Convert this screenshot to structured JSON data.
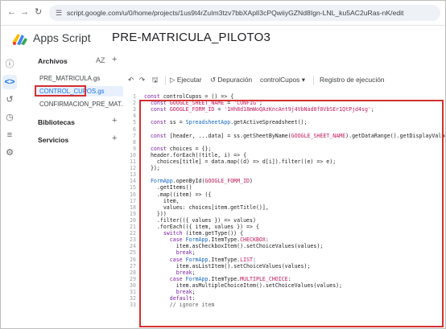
{
  "browser": {
    "url": "script.google.com/u/0/home/projects/1us9t4rZuIm3tzv7bbXAplI3cPQwiiyGZNd8Ign-LNL_ku5AC2uRas-nK/edit",
    "back_icon": "arrow-left-icon",
    "forward_icon": "arrow-right-icon",
    "reload_icon": "reload-icon"
  },
  "header": {
    "app_name": "Apps Script",
    "project_title": "PRE-MATRICULA_PILOTO3"
  },
  "files_panel": {
    "archivos_label": "Archivos",
    "sort_label": "AZ",
    "files": [
      {
        "name": "PRE_MATRICULA.gs",
        "active": false
      },
      {
        "name": "CONTROL_CUPOS.gs",
        "active": true
      },
      {
        "name": "CONFIRMACION_PRE_MAT...",
        "active": false
      }
    ],
    "bibliotecas_label": "Bibliotecas",
    "servicios_label": "Servicios"
  },
  "toolbar": {
    "run_label": "Ejecutar",
    "debug_label": "Depuración",
    "function_select": "controlCupos",
    "log_label": "Registro de ejecución"
  },
  "editor": {
    "lines": [
      "const controlCupos = () => {",
      "  const GOOGLE_SHEET_NAME = 'CONFIG';",
      "  const GOOGLE_FORM_ID = '1Hh8d18mWoQAzKncAnt9j4VbNad0f0VbSEr1QtPjd4sg';",
      "",
      "  const ss = SpreadsheetApp.getActiveSpreadsheet();",
      "",
      "  const [header, ...data] = ss.getSheetByName(GOOGLE_SHEET_NAME).getDataRange().getDisplayValues();",
      "",
      "  const choices = {};",
      "  header.forEach((title, i) => {",
      "    choices[title] = data.map((d) => d[i]).filter((e) => e);",
      "  });",
      "",
      "  FormApp.openById(GOOGLE_FORM_ID)",
      "    .getItems()",
      "    .map((item) => ({",
      "      item,",
      "      values: choices[item.getTitle()],",
      "    }))",
      "    .filter(({ values }) => values)",
      "    .forEach(({ item, values }) => {",
      "      switch (item.getType()) {",
      "        case FormApp.ItemType.CHECKBOX:",
      "          item.asCheckboxItem().setChoiceValues(values);",
      "          break;",
      "        case FormApp.ItemType.LIST:",
      "          item.asListItem().setChoiceValues(values);",
      "          break;",
      "        case FormApp.ItemType.MULTIPLE_CHOICE:",
      "          item.asMultipleChoiceItem().setChoiceValues(values);",
      "          break;",
      "        default:",
      "        // ignore item"
    ]
  }
}
